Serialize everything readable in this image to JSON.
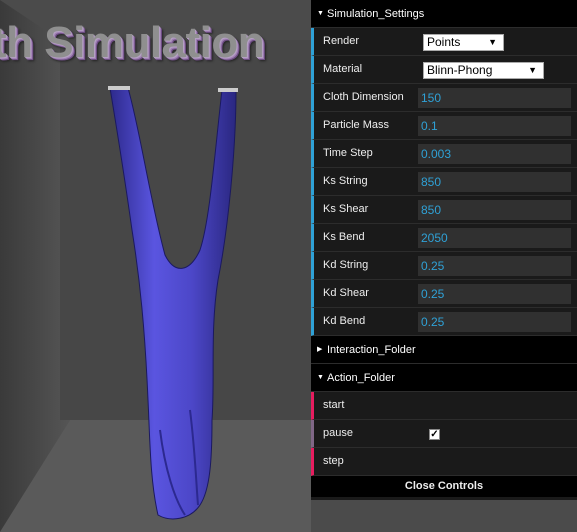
{
  "scene": {
    "title_text": "th Simulation",
    "cloth_color": "#5a55e0",
    "background_color": "#4a4a4a"
  },
  "gui": {
    "simulation_folder": {
      "title": "Simulation_Settings",
      "render": {
        "label": "Render",
        "value": "Points"
      },
      "material": {
        "label": "Material",
        "value": "Blinn-Phong"
      },
      "params": [
        {
          "label": "Cloth Dimension",
          "value": "150"
        },
        {
          "label": "Particle Mass",
          "value": "0.1"
        },
        {
          "label": "Time Step",
          "value": "0.003"
        },
        {
          "label": "Ks String",
          "value": "850"
        },
        {
          "label": "Ks Shear",
          "value": "850"
        },
        {
          "label": "Ks Bend",
          "value": "2050"
        },
        {
          "label": "Kd String",
          "value": "0.25"
        },
        {
          "label": "Kd Shear",
          "value": "0.25"
        },
        {
          "label": "Kd Bend",
          "value": "0.25"
        }
      ]
    },
    "interaction_folder": {
      "title": "Interaction_Folder"
    },
    "action_folder": {
      "title": "Action_Folder",
      "start_label": "start",
      "pause_label": "pause",
      "pause_checked": true,
      "step_label": "step"
    },
    "close_label": "Close Controls"
  }
}
